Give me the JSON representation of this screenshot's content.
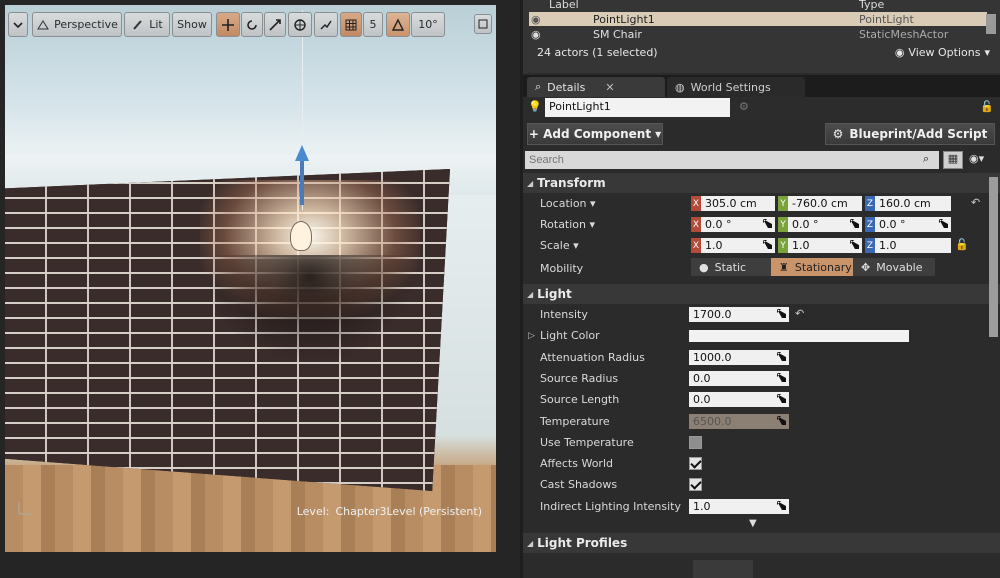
{
  "viewport": {
    "toolbar": {
      "perspective": "Perspective",
      "lit": "Lit",
      "show": "Show",
      "grid_value": "5",
      "angle_value": "10°"
    },
    "level_label": "Level:",
    "level_name": "Chapter3Level (Persistent)"
  },
  "outliner": {
    "col_label": "Label",
    "col_type": "Type",
    "rows": [
      {
        "label": "PointLight1",
        "type": "PointLight"
      },
      {
        "label": "SM Chair",
        "type": "StaticMeshActor"
      }
    ],
    "actor_count": "24 actors (1 selected)",
    "view_options": "View Options"
  },
  "tabs": [
    {
      "label": "Details"
    },
    {
      "label": "World Settings"
    }
  ],
  "details": {
    "name": "PointLight1",
    "add_component": "+ Add Component",
    "blueprint": "Blueprint/Add Script",
    "search_placeholder": "Search",
    "transform": {
      "title": "Transform",
      "location_label": "Location",
      "location": {
        "x": "305.0 cm",
        "y": "-760.0 cm",
        "z": "160.0 cm"
      },
      "rotation_label": "Rotation",
      "rotation": {
        "x": "0.0 °",
        "y": "0.0 °",
        "z": "0.0 °"
      },
      "scale_label": "Scale",
      "scale": {
        "x": "1.0",
        "y": "1.0",
        "z": "1.0"
      },
      "mobility_label": "Mobility",
      "mobility": [
        "Static",
        "Stationary",
        "Movable"
      ],
      "mobility_selected": "Stationary"
    },
    "light": {
      "title": "Light",
      "intensity_label": "Intensity",
      "intensity": "1700.0",
      "light_color_label": "Light Color",
      "light_color": "#f2f2f2",
      "attenuation_label": "Attenuation Radius",
      "attenuation": "1000.0",
      "source_radius_label": "Source Radius",
      "source_radius": "0.0",
      "source_length_label": "Source Length",
      "source_length": "0.0",
      "temperature_label": "Temperature",
      "temperature": "6500.0",
      "use_temperature_label": "Use Temperature",
      "use_temperature": false,
      "affects_world_label": "Affects World",
      "affects_world": true,
      "cast_shadows_label": "Cast Shadows",
      "cast_shadows": true,
      "indirect_label": "Indirect Lighting Intensity",
      "indirect": "1.0"
    },
    "light_profiles_title": "Light Profiles"
  },
  "colors": {
    "accent": "#c9946a",
    "axis_x": "#b34a3a",
    "axis_y": "#7aa33a",
    "axis_z": "#3a68b3"
  }
}
